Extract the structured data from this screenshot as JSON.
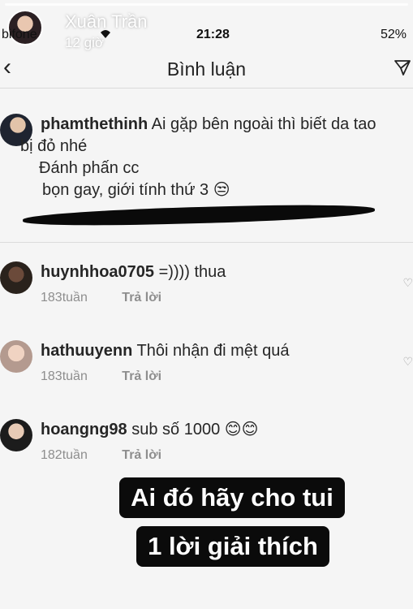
{
  "story": {
    "user": "Xuân Trần",
    "time": "12 giờ"
  },
  "status_bar": {
    "carrier": "bifone",
    "time": "21:28",
    "battery": "52%"
  },
  "nav": {
    "title": "Bình luận"
  },
  "main_comment": {
    "username": "phamthethinh",
    "line1": "Ai gặp bên ngoài thì biết da tao",
    "line2": "bị đỏ nhé",
    "line3": "Đánh phấn cc",
    "line4": "bọn gay,     giới tính thứ 3 😒"
  },
  "replies": [
    {
      "username": "huynhhoa0705",
      "text": "=)))) thua",
      "time": "183tuần",
      "reply_label": "Trả lời"
    },
    {
      "username": "hathuuyenn",
      "text": "Thôi nhận đi mệt quá",
      "time": "183tuần",
      "reply_label": "Trả lời"
    },
    {
      "username": "hoangng98",
      "text": "sub số 1000 😊😊",
      "time": "182tuần",
      "reply_label": "Trả lời"
    }
  ],
  "caption": {
    "line1": "Ai đó hãy cho tui",
    "line2": "1 lời giải thích"
  }
}
